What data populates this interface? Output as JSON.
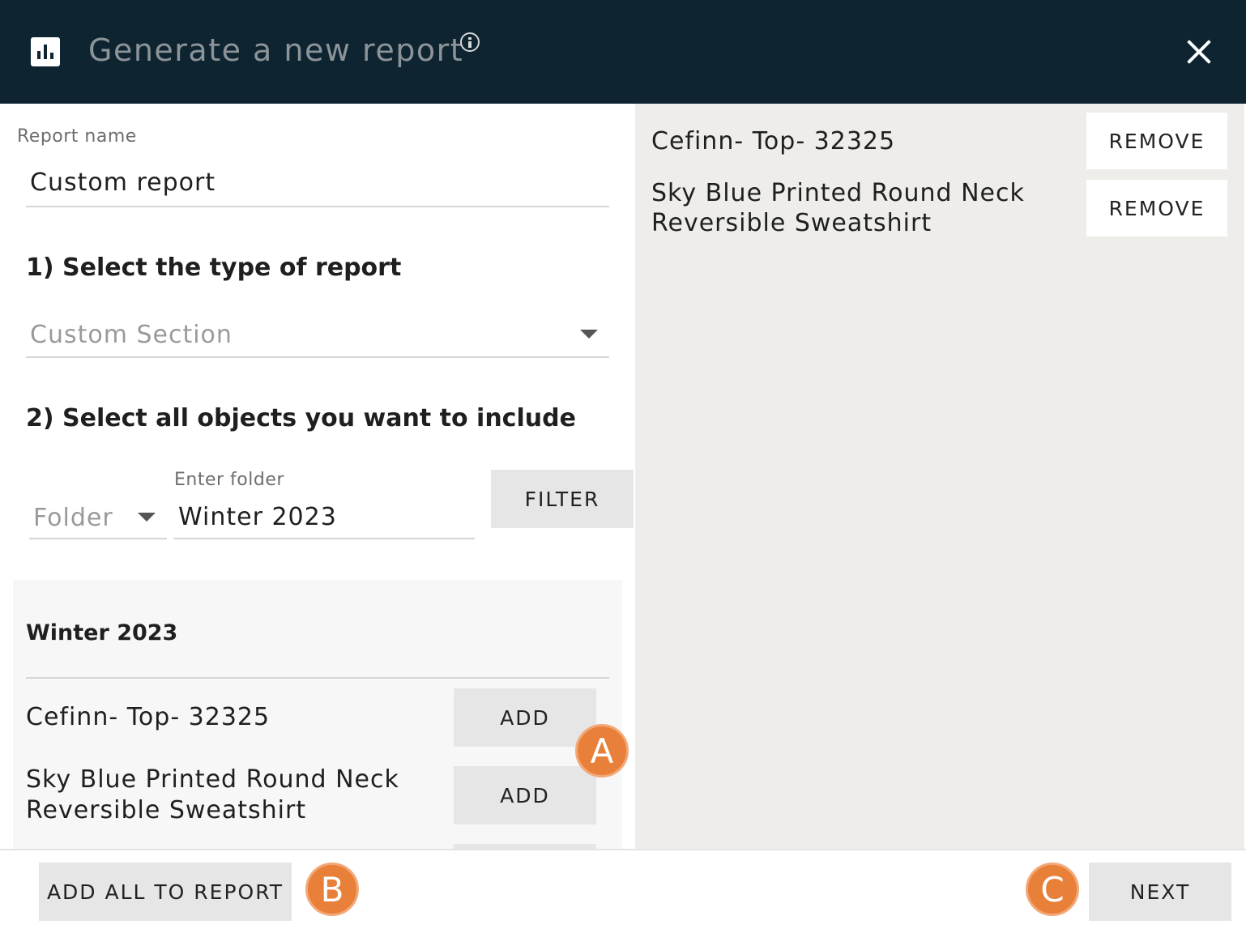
{
  "header": {
    "title": "Generate a new report",
    "icon": "report-chart-icon",
    "info_icon": "info-icon",
    "close_icon": "close-icon"
  },
  "report_name": {
    "label": "Report name",
    "value": "Custom report"
  },
  "step1": {
    "heading": "1) Select the type of report",
    "select_placeholder": "Custom Section"
  },
  "step2": {
    "heading": "2) Select all objects you want to include",
    "folder_select_placeholder": "Folder",
    "folder_input_label": "Enter folder",
    "folder_input_value": "Winter 2023",
    "filter_label": "FILTER"
  },
  "object_list": {
    "heading": "Winter 2023",
    "add_label": "ADD",
    "items": [
      {
        "name": "Cefinn- Top- 32325"
      },
      {
        "name": "Sky Blue Printed Round Neck Reversible Sweatshirt"
      }
    ]
  },
  "selected": {
    "remove_label": "REMOVE",
    "items": [
      {
        "name": "Cefinn- Top- 32325"
      },
      {
        "name": "Sky Blue Printed Round Neck Reversible Sweatshirt"
      }
    ]
  },
  "footer": {
    "add_all_label": "ADD ALL TO REPORT",
    "next_label": "NEXT"
  },
  "markers": {
    "a": "A",
    "b": "B",
    "c": "C"
  },
  "colors": {
    "header_bg": "#0e2430",
    "right_panel_bg": "#eeedea",
    "button_grey": "#e6e6e6",
    "marker_orange": "#e8803a"
  }
}
